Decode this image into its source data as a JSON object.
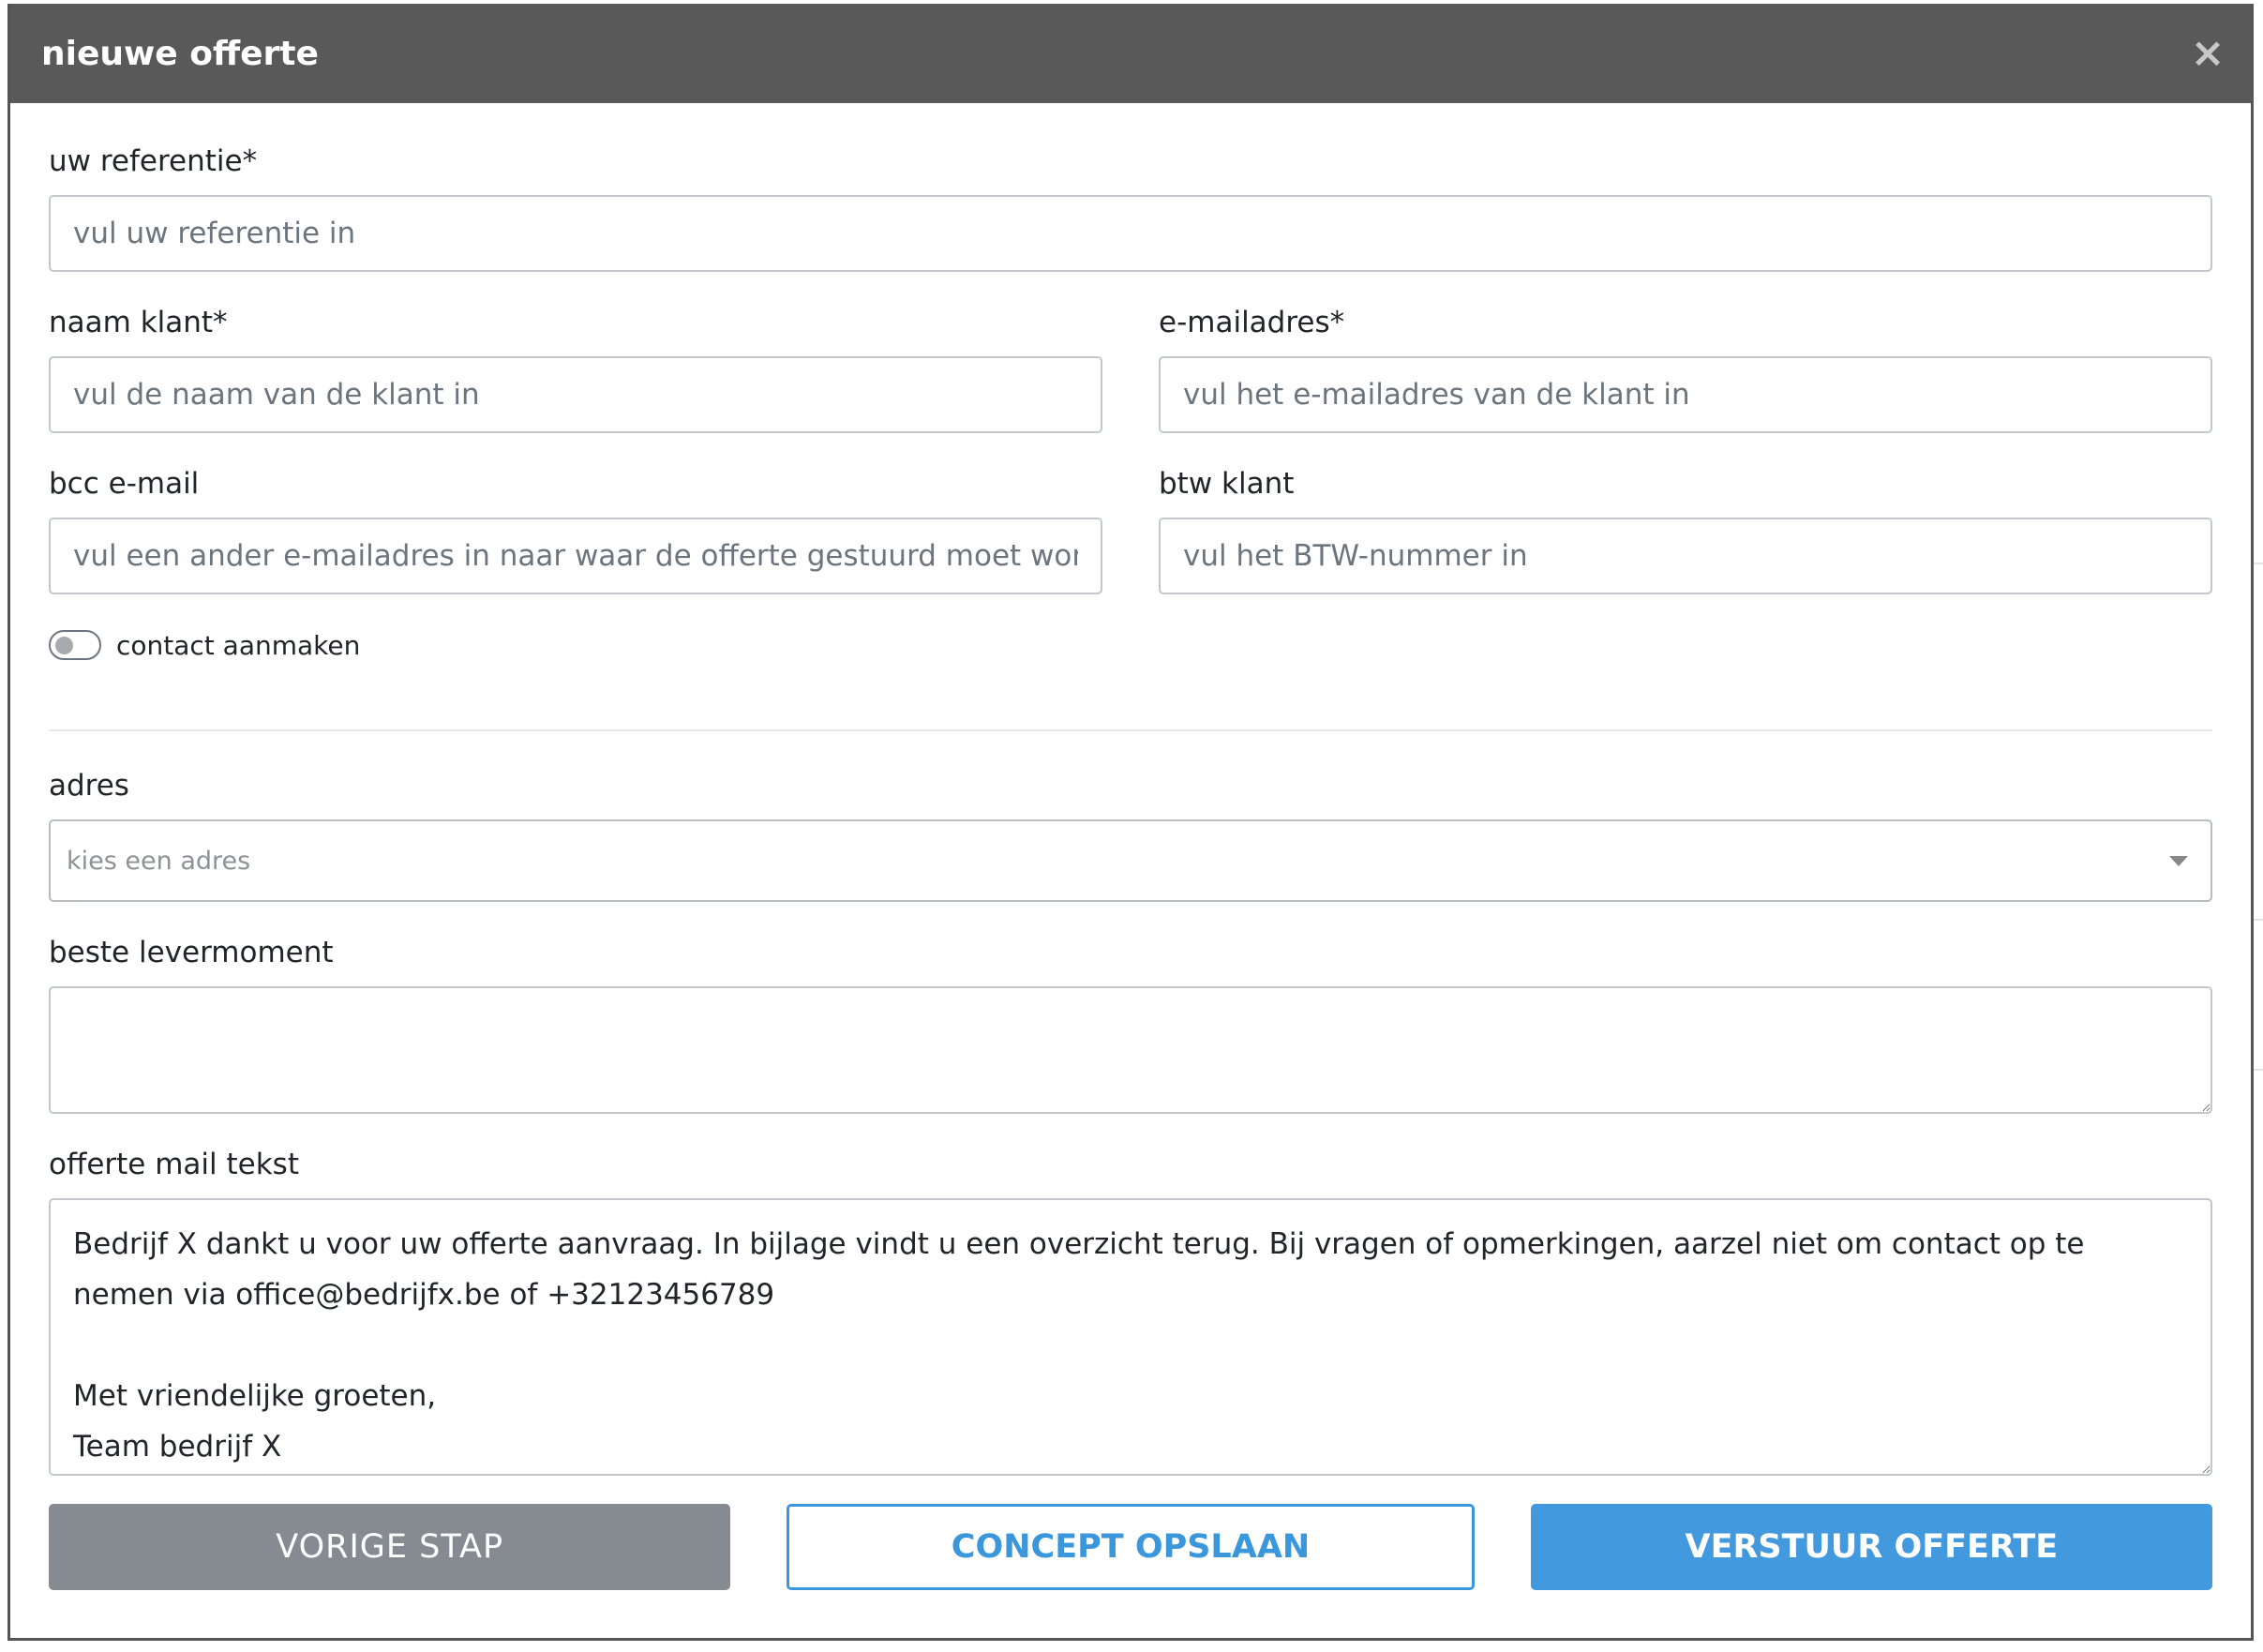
{
  "modal": {
    "title": "nieuwe offerte",
    "close_icon": "close-icon",
    "close_symbol": "×"
  },
  "form": {
    "reference": {
      "label": "uw referentie*",
      "placeholder": "vul uw referentie in",
      "value": ""
    },
    "customer_name": {
      "label": "naam klant*",
      "placeholder": "vul de naam van de klant in",
      "value": ""
    },
    "email": {
      "label": "e-mailadres*",
      "placeholder": "vul het e-mailadres van de klant in",
      "value": ""
    },
    "bcc_email": {
      "label": "bcc e-mail",
      "placeholder": "vul een ander e-mailadres in naar waar de offerte gestuurd moet worden",
      "value": ""
    },
    "vat": {
      "label": "btw klant",
      "placeholder": "vul het BTW-nummer in",
      "value": ""
    },
    "create_contact": {
      "label": "contact aanmaken",
      "checked": false
    },
    "address": {
      "label": "adres",
      "placeholder": "kies een adres"
    },
    "delivery_moment": {
      "label": "beste levermoment",
      "value": ""
    },
    "mail_text": {
      "label": "offerte mail tekst",
      "value": "Bedrijf X dankt u voor uw offerte aanvraag. In bijlage vindt u een overzicht terug. Bij vragen of opmerkingen, aarzel niet om contact op te nemen via office@bedrijfx.be of +32123456789\n\nMet vriendelijke groeten,\nTeam bedrijf X"
    }
  },
  "actions": {
    "previous_label": "VORIGE STAP",
    "concept_label": "CONCEPT OPSLAAN",
    "send_label": "VERSTUUR OFFERTE"
  },
  "colors": {
    "header_bg": "#595959",
    "primary": "#4399de",
    "secondary": "#868b91"
  }
}
